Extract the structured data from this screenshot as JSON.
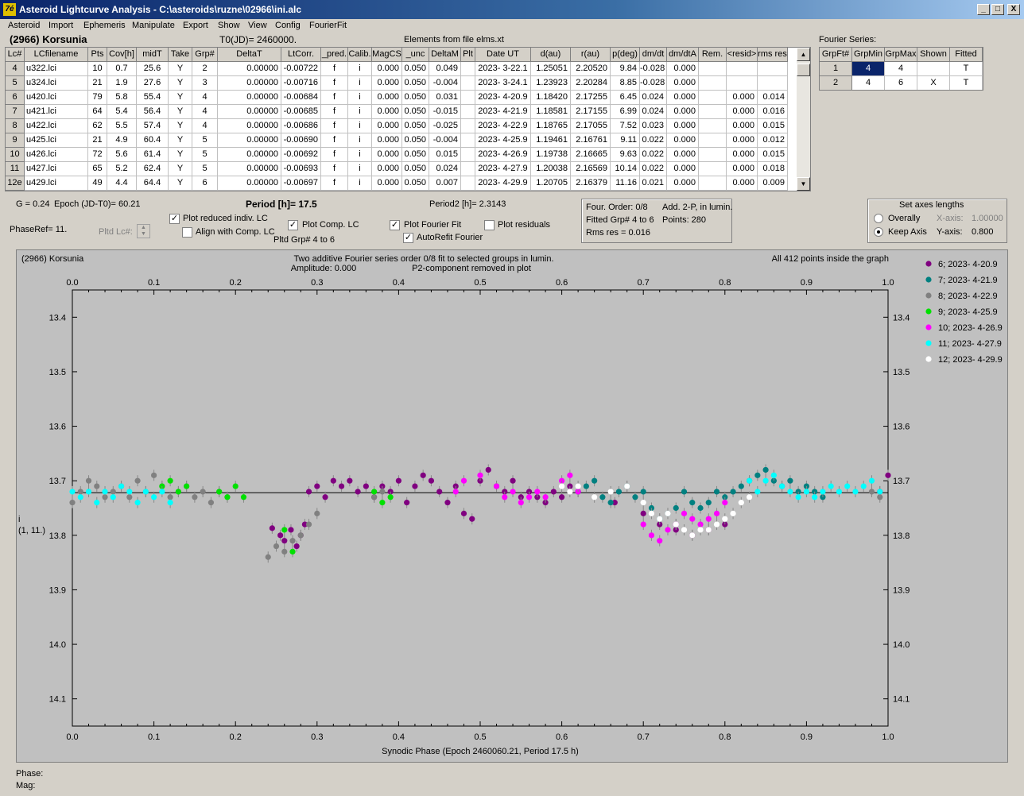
{
  "window": {
    "title": "Asteroid Lightcurve Analysis - C:\\asteroids\\ruzne\\02966\\ini.alc",
    "app_icon": "7é",
    "minimize": "_",
    "maximize": "□",
    "close": "X"
  },
  "menu": [
    "Asteroid",
    "Import",
    "Ephemeris",
    "Manipulate",
    "Export",
    "Show",
    "View",
    "Config",
    "FourierFit"
  ],
  "header": {
    "asteroid": "(2966) Korsunia",
    "t0": "T0(JD)= 2460000.",
    "elements": "Elements from file elms.xt",
    "fourier_label": "Fourier Series:"
  },
  "table": {
    "columns": [
      "Lc#",
      "LCfilename",
      "Pts",
      "Cov[h]",
      "midT",
      "Take",
      "Grp#",
      "DeltaT",
      "LtCorr.",
      "_pred.",
      "Calib.",
      "MagCS",
      "_unc",
      "DeltaM",
      "Plt",
      "Date UT",
      "d(au)",
      "r(au)",
      "p(deg)",
      "dm/dt",
      "dm/dtA",
      "Rem.",
      "<resid>",
      "rms res"
    ],
    "rows": [
      [
        "4",
        "u322.lci",
        "10",
        "0.7",
        "25.6",
        "Y",
        "2",
        "0.00000",
        "-0.00722",
        "f",
        "i",
        "0.000",
        "0.050",
        "0.049",
        "",
        "2023- 3-22.1",
        "1.25051",
        "2.20520",
        "9.84",
        "-0.028",
        "0.000",
        "",
        "",
        ""
      ],
      [
        "5",
        "u324.lci",
        "21",
        "1.9",
        "27.6",
        "Y",
        "3",
        "0.00000",
        "-0.00716",
        "f",
        "i",
        "0.000",
        "0.050",
        "-0.004",
        "",
        "2023- 3-24.1",
        "1.23923",
        "2.20284",
        "8.85",
        "-0.028",
        "0.000",
        "",
        "",
        ""
      ],
      [
        "6",
        "u420.lci",
        "79",
        "5.8",
        "55.4",
        "Y",
        "4",
        "0.00000",
        "-0.00684",
        "f",
        "i",
        "0.000",
        "0.050",
        "0.031",
        "",
        "2023- 4-20.9",
        "1.18420",
        "2.17255",
        "6.45",
        "0.024",
        "0.000",
        "",
        "0.000",
        "0.014"
      ],
      [
        "7",
        "u421.lci",
        "64",
        "5.4",
        "56.4",
        "Y",
        "4",
        "0.00000",
        "-0.00685",
        "f",
        "i",
        "0.000",
        "0.050",
        "-0.015",
        "",
        "2023- 4-21.9",
        "1.18581",
        "2.17155",
        "6.99",
        "0.024",
        "0.000",
        "",
        "0.000",
        "0.016"
      ],
      [
        "8",
        "u422.lci",
        "62",
        "5.5",
        "57.4",
        "Y",
        "4",
        "0.00000",
        "-0.00686",
        "f",
        "i",
        "0.000",
        "0.050",
        "-0.025",
        "",
        "2023- 4-22.9",
        "1.18765",
        "2.17055",
        "7.52",
        "0.023",
        "0.000",
        "",
        "0.000",
        "0.015"
      ],
      [
        "9",
        "u425.lci",
        "21",
        "4.9",
        "60.4",
        "Y",
        "5",
        "0.00000",
        "-0.00690",
        "f",
        "i",
        "0.000",
        "0.050",
        "-0.004",
        "",
        "2023- 4-25.9",
        "1.19461",
        "2.16761",
        "9.11",
        "0.022",
        "0.000",
        "",
        "0.000",
        "0.012"
      ],
      [
        "10",
        "u426.lci",
        "72",
        "5.6",
        "61.4",
        "Y",
        "5",
        "0.00000",
        "-0.00692",
        "f",
        "i",
        "0.000",
        "0.050",
        "0.015",
        "",
        "2023- 4-26.9",
        "1.19738",
        "2.16665",
        "9.63",
        "0.022",
        "0.000",
        "",
        "0.000",
        "0.015"
      ],
      [
        "11",
        "u427.lci",
        "65",
        "5.2",
        "62.4",
        "Y",
        "5",
        "0.00000",
        "-0.00693",
        "f",
        "i",
        "0.000",
        "0.050",
        "0.024",
        "",
        "2023- 4-27.9",
        "1.20038",
        "2.16569",
        "10.14",
        "0.022",
        "0.000",
        "",
        "0.000",
        "0.018"
      ],
      [
        "12e",
        "u429.lci",
        "49",
        "4.4",
        "64.4",
        "Y",
        "6",
        "0.00000",
        "-0.00697",
        "f",
        "i",
        "0.000",
        "0.050",
        "0.007",
        "",
        "2023- 4-29.9",
        "1.20705",
        "2.16379",
        "11.16",
        "0.021",
        "0.000",
        "",
        "0.000",
        "0.009"
      ]
    ]
  },
  "fourier_table": {
    "columns": [
      "GrpFt#",
      "GrpMin",
      "GrpMax",
      "Shown",
      "Fitted"
    ],
    "rows": [
      [
        "1",
        "4",
        "4",
        "",
        "T"
      ],
      [
        "2",
        "4",
        "6",
        "X",
        "T"
      ]
    ]
  },
  "controls": {
    "g_param": "G = 0.24",
    "epoch": "Epoch (JD-T0)= 60.21",
    "period": "Period [h]= 17.5",
    "period2": "Period2 [h]= 2.3143",
    "phaseref": "PhaseRef= 11.",
    "pltd_lc": "Pltd Lc#:",
    "plot_reduced": "Plot reduced indiv. LC",
    "align_comp": "Align with Comp. LC",
    "plot_comp": "Plot Comp. LC",
    "pltd_grp": "Pltd Grp#  4  to  6",
    "plot_fourier": "Plot Fourier Fit",
    "autorefit": "AutoRefit Fourier",
    "plot_residuals": "Plot residuals",
    "checks": {
      "plot_reduced": true,
      "align_comp": false,
      "plot_comp": true,
      "plot_fourier": true,
      "autorefit": true,
      "plot_residuals": false
    }
  },
  "fourier_info": {
    "order": "Four. Order:  0/8",
    "add": "Add. 2-P, in lumin.",
    "fitted": "Fitted Grp# 4 to 6",
    "points": "Points: 280",
    "rms": "Rms res     = 0.016"
  },
  "axes_box": {
    "title": "Set axes lengths",
    "overally": "Overally",
    "keep_axis": "Keep Axis",
    "xaxis_label": "X-axis:",
    "xaxis_value": "1.00000",
    "yaxis_label": "Y-axis:",
    "yaxis_value": "0.800",
    "selected": "keep_axis"
  },
  "chart_data": {
    "type": "scatter",
    "title_left": "(2966) Korsunia",
    "title_center": "Two additive Fourier series order 0/8 fit to selected groups in lumin.",
    "amplitude": "Amplitude: 0.000",
    "p2note": "P2-component removed in plot",
    "inside": "All 412 points inside the graph",
    "xlabel": "Synodic Phase (Epoch 2460060.21, Period 17.5 h)",
    "ylabel_1": "i",
    "ylabel_2": "(1, 11.)",
    "xlim": [
      0,
      1
    ],
    "ylim": [
      14.15,
      13.35
    ],
    "y_inverted": true,
    "xticks": [
      "0.0",
      "0.1",
      "0.2",
      "0.3",
      "0.4",
      "0.5",
      "0.6",
      "0.7",
      "0.8",
      "0.9",
      "1.0"
    ],
    "yticks": [
      "13.4",
      "13.5",
      "13.6",
      "13.7",
      "13.8",
      "13.9",
      "14.0",
      "14.1"
    ],
    "fit_line": 13.722,
    "series": [
      {
        "name": "6; 2023- 4-20.9",
        "color": "#800080",
        "points": [
          [
            0.245,
            13.787
          ],
          [
            0.255,
            13.8
          ],
          [
            0.26,
            13.81
          ],
          [
            0.268,
            13.79
          ],
          [
            0.275,
            13.82
          ],
          [
            0.28,
            13.8
          ],
          [
            0.285,
            13.78
          ],
          [
            0.29,
            13.72
          ],
          [
            0.3,
            13.71
          ],
          [
            0.31,
            13.73
          ],
          [
            0.32,
            13.7
          ],
          [
            0.33,
            13.71
          ],
          [
            0.34,
            13.7
          ],
          [
            0.35,
            13.72
          ],
          [
            0.36,
            13.71
          ],
          [
            0.37,
            13.73
          ],
          [
            0.38,
            13.71
          ],
          [
            0.39,
            13.72
          ],
          [
            0.4,
            13.7
          ],
          [
            0.41,
            13.74
          ],
          [
            0.42,
            13.71
          ],
          [
            0.43,
            13.69
          ],
          [
            0.44,
            13.7
          ],
          [
            0.45,
            13.72
          ],
          [
            0.46,
            13.74
          ],
          [
            0.47,
            13.71
          ],
          [
            0.48,
            13.76
          ],
          [
            0.49,
            13.77
          ],
          [
            0.5,
            13.7
          ],
          [
            0.51,
            13.68
          ],
          [
            0.52,
            13.71
          ],
          [
            0.53,
            13.72
          ],
          [
            0.54,
            13.7
          ],
          [
            0.55,
            13.73
          ],
          [
            0.56,
            13.72
          ],
          [
            0.57,
            13.73
          ],
          [
            0.58,
            13.74
          ],
          [
            0.59,
            13.72
          ],
          [
            0.6,
            13.73
          ],
          [
            0.61,
            13.71
          ],
          [
            0.62,
            13.72
          ],
          [
            0.665,
            13.74
          ],
          [
            0.7,
            13.76
          ],
          [
            0.72,
            13.78
          ],
          [
            0.74,
            13.79
          ],
          [
            0.76,
            13.8
          ],
          [
            0.78,
            13.79
          ],
          [
            0.8,
            13.78
          ],
          [
            0.99,
            13.72
          ],
          [
            1.0,
            13.69
          ]
        ]
      },
      {
        "name": "7; 2023- 4-21.9",
        "color": "#008080",
        "points": [
          [
            0.62,
            13.72
          ],
          [
            0.63,
            13.71
          ],
          [
            0.64,
            13.7
          ],
          [
            0.65,
            13.73
          ],
          [
            0.66,
            13.74
          ],
          [
            0.67,
            13.72
          ],
          [
            0.68,
            13.71
          ],
          [
            0.69,
            13.73
          ],
          [
            0.7,
            13.72
          ],
          [
            0.71,
            13.75
          ],
          [
            0.72,
            13.77
          ],
          [
            0.73,
            13.76
          ],
          [
            0.74,
            13.75
          ],
          [
            0.75,
            13.72
          ],
          [
            0.76,
            13.74
          ],
          [
            0.77,
            13.75
          ],
          [
            0.78,
            13.74
          ],
          [
            0.79,
            13.72
          ],
          [
            0.8,
            13.73
          ],
          [
            0.81,
            13.72
          ],
          [
            0.82,
            13.71
          ],
          [
            0.83,
            13.7
          ],
          [
            0.84,
            13.69
          ],
          [
            0.85,
            13.68
          ],
          [
            0.86,
            13.7
          ],
          [
            0.87,
            13.71
          ],
          [
            0.88,
            13.7
          ],
          [
            0.89,
            13.72
          ],
          [
            0.9,
            13.71
          ],
          [
            0.91,
            13.72
          ],
          [
            0.92,
            13.73
          ]
        ]
      },
      {
        "name": "8; 2023- 4-22.9",
        "color": "#808080",
        "points": [
          [
            0.0,
            13.74
          ],
          [
            0.01,
            13.72
          ],
          [
            0.02,
            13.7
          ],
          [
            0.03,
            13.71
          ],
          [
            0.04,
            13.73
          ],
          [
            0.05,
            13.72
          ],
          [
            0.06,
            13.71
          ],
          [
            0.07,
            13.73
          ],
          [
            0.08,
            13.7
          ],
          [
            0.09,
            13.72
          ],
          [
            0.1,
            13.69
          ],
          [
            0.11,
            13.71
          ],
          [
            0.12,
            13.73
          ],
          [
            0.13,
            13.72
          ],
          [
            0.14,
            13.71
          ],
          [
            0.15,
            13.73
          ],
          [
            0.16,
            13.72
          ],
          [
            0.17,
            13.74
          ],
          [
            0.18,
            13.72
          ],
          [
            0.19,
            13.73
          ],
          [
            0.24,
            13.84
          ],
          [
            0.25,
            13.82
          ],
          [
            0.26,
            13.83
          ],
          [
            0.27,
            13.81
          ],
          [
            0.28,
            13.8
          ],
          [
            0.29,
            13.78
          ],
          [
            0.3,
            13.76
          ],
          [
            0.37,
            13.73
          ],
          [
            0.38,
            13.72
          ],
          [
            0.98,
            13.72
          ],
          [
            0.99,
            13.73
          ]
        ]
      },
      {
        "name": "9; 2023- 4-25.9",
        "color": "#00e000",
        "points": [
          [
            0.11,
            13.71
          ],
          [
            0.12,
            13.7
          ],
          [
            0.13,
            13.72
          ],
          [
            0.14,
            13.71
          ],
          [
            0.18,
            13.72
          ],
          [
            0.19,
            13.73
          ],
          [
            0.2,
            13.71
          ],
          [
            0.21,
            13.73
          ],
          [
            0.26,
            13.79
          ],
          [
            0.27,
            13.83
          ],
          [
            0.37,
            13.72
          ],
          [
            0.38,
            13.74
          ],
          [
            0.39,
            13.73
          ]
        ]
      },
      {
        "name": "10; 2023- 4-26.9",
        "color": "#ff00ff",
        "points": [
          [
            0.47,
            13.72
          ],
          [
            0.48,
            13.7
          ],
          [
            0.5,
            13.69
          ],
          [
            0.52,
            13.71
          ],
          [
            0.53,
            13.73
          ],
          [
            0.54,
            13.72
          ],
          [
            0.55,
            13.74
          ],
          [
            0.56,
            13.73
          ],
          [
            0.57,
            13.72
          ],
          [
            0.58,
            13.73
          ],
          [
            0.6,
            13.7
          ],
          [
            0.61,
            13.69
          ],
          [
            0.62,
            13.72
          ],
          [
            0.7,
            13.78
          ],
          [
            0.71,
            13.8
          ],
          [
            0.72,
            13.81
          ],
          [
            0.73,
            13.79
          ],
          [
            0.74,
            13.78
          ],
          [
            0.75,
            13.76
          ],
          [
            0.76,
            13.77
          ],
          [
            0.77,
            13.78
          ],
          [
            0.78,
            13.77
          ],
          [
            0.79,
            13.76
          ],
          [
            0.8,
            13.74
          ]
        ]
      },
      {
        "name": "11; 2023- 4-27.9",
        "color": "#00ffff",
        "points": [
          [
            0.0,
            13.72
          ],
          [
            0.01,
            13.73
          ],
          [
            0.02,
            13.72
          ],
          [
            0.03,
            13.74
          ],
          [
            0.04,
            13.72
          ],
          [
            0.05,
            13.73
          ],
          [
            0.06,
            13.71
          ],
          [
            0.07,
            13.72
          ],
          [
            0.08,
            13.74
          ],
          [
            0.09,
            13.72
          ],
          [
            0.1,
            13.73
          ],
          [
            0.11,
            13.72
          ],
          [
            0.12,
            13.74
          ],
          [
            0.83,
            13.7
          ],
          [
            0.84,
            13.72
          ],
          [
            0.85,
            13.7
          ],
          [
            0.86,
            13.69
          ],
          [
            0.87,
            13.71
          ],
          [
            0.88,
            13.72
          ],
          [
            0.89,
            13.73
          ],
          [
            0.9,
            13.72
          ],
          [
            0.91,
            13.73
          ],
          [
            0.92,
            13.72
          ],
          [
            0.93,
            13.71
          ],
          [
            0.94,
            13.72
          ],
          [
            0.95,
            13.71
          ],
          [
            0.96,
            13.72
          ],
          [
            0.97,
            13.71
          ],
          [
            0.98,
            13.7
          ],
          [
            0.99,
            13.72
          ]
        ]
      },
      {
        "name": "12; 2023- 4-29.9",
        "color": "#ffffff",
        "points": [
          [
            0.6,
            13.71
          ],
          [
            0.61,
            13.72
          ],
          [
            0.62,
            13.71
          ],
          [
            0.64,
            13.73
          ],
          [
            0.66,
            13.72
          ],
          [
            0.68,
            13.71
          ],
          [
            0.7,
            13.74
          ],
          [
            0.71,
            13.76
          ],
          [
            0.72,
            13.77
          ],
          [
            0.73,
            13.76
          ],
          [
            0.74,
            13.78
          ],
          [
            0.75,
            13.79
          ],
          [
            0.76,
            13.8
          ],
          [
            0.77,
            13.79
          ],
          [
            0.78,
            13.79
          ],
          [
            0.79,
            13.78
          ],
          [
            0.8,
            13.77
          ],
          [
            0.81,
            13.76
          ],
          [
            0.82,
            13.74
          ],
          [
            0.83,
            13.73
          ]
        ]
      }
    ]
  },
  "status": {
    "phase": "Phase:",
    "mag": "Mag:"
  }
}
